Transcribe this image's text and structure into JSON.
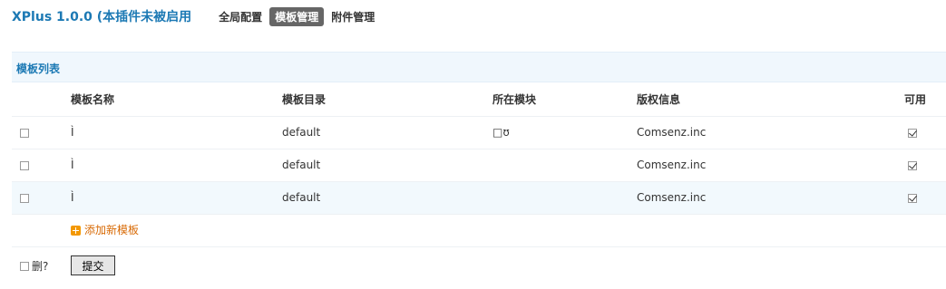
{
  "header": {
    "plugin_title": "XPlus 1.0.0 (本插件未被启用",
    "nav": [
      "全局配置",
      "模板管理",
      "附件管理"
    ]
  },
  "section": {
    "title": "模板列表"
  },
  "table": {
    "columns": [
      "模板名称",
      "模板目录",
      "所在模块",
      "版权信息",
      "可用"
    ],
    "rows": [
      {
        "name": "Ì",
        "dir": "default",
        "module": "□ʊ",
        "copyright": "Comsenz.inc",
        "available": true
      },
      {
        "name": "Ì",
        "dir": "default",
        "module": "",
        "copyright": "Comsenz.inc",
        "available": true
      },
      {
        "name": "Ì",
        "dir": "default",
        "module": "",
        "copyright": "Comsenz.inc",
        "available": true
      }
    ]
  },
  "add_template_label": "添加新模板",
  "footer": {
    "delete_label": "删?",
    "submit_label": "提交"
  }
}
